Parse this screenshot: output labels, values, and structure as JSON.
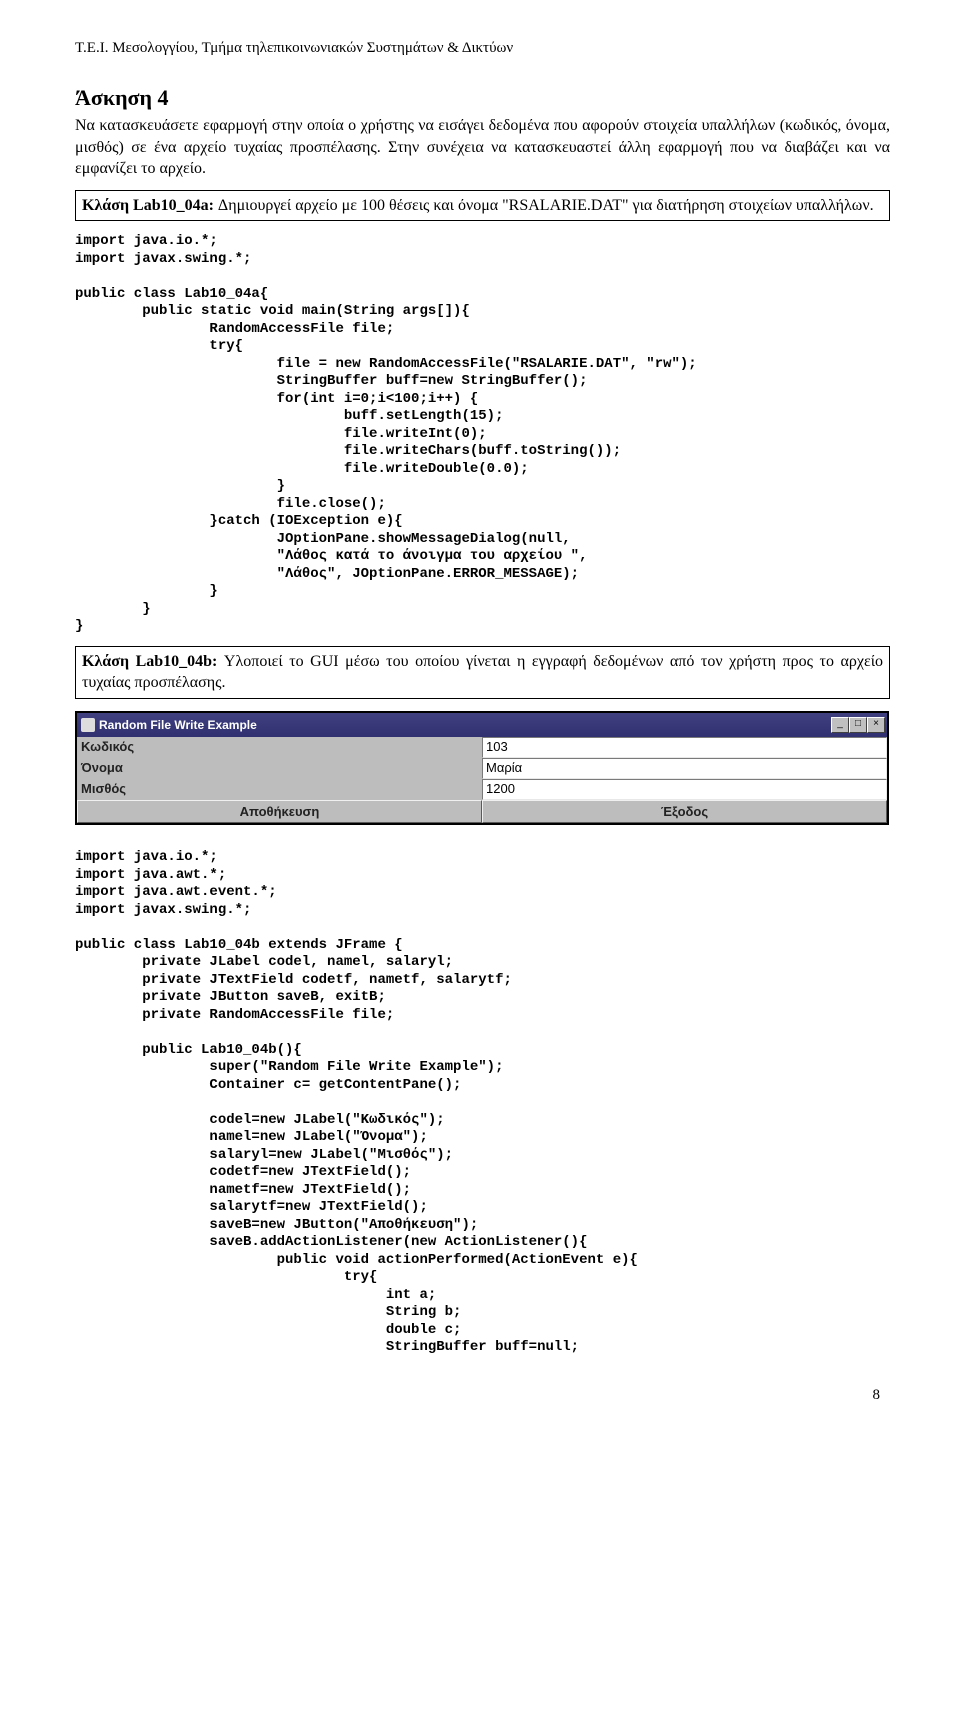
{
  "header": "T.E.I. Μεσολογγίου, Τμήμα τηλεπικοινωνιακών Συστημάτων & Δικτύων",
  "exercise_title": "Άσκηση 4",
  "intro": "Να κατασκευάσετε εφαρμογή στην οποία ο χρήστης να εισάγει δεδομένα που αφορούν στοιχεία υπαλλήλων (κωδικός, όνομα, μισθός) σε ένα αρχείο τυχαίας προσπέλασης. Στην συνέχεια να κατασκευαστεί άλλη εφαρμογή που να διαβάζει και να εμφανίζει το αρχείο.",
  "box1_label": "Κλάση Lab10_04a:",
  "box1_rest": " Δημιουργεί αρχείο με 100 θέσεις και όνομα \"RSALARIE.DAT\" για διατήρηση στοιχείων υπαλλήλων.",
  "code1": "import java.io.*;\nimport javax.swing.*;\n\npublic class Lab10_04a{\n        public static void main(String args[]){\n                RandomAccessFile file;\n                try{\n                        file = new RandomAccessFile(\"RSALARIE.DAT\", \"rw\");\n                        StringBuffer buff=new StringBuffer();\n                        for(int i=0;i<100;i++) {\n                                buff.setLength(15);\n                                file.writeInt(0);\n                                file.writeChars(buff.toString());\n                                file.writeDouble(0.0);\n                        }\n                        file.close();\n                }catch (IOException e){\n                        JOptionPane.showMessageDialog(null,\n                        \"Λάθος κατά το άνοιγμα του αρχείου \",\n                        \"Λάθος\", JOptionPane.ERROR_MESSAGE);\n                }\n        }\n}",
  "box2_label": "Κλάση Lab10_04b:",
  "box2_rest": " Υλοποιεί το GUI μέσω του οποίου γίνεται η εγγραφή  δεδομένων από τον χρήστη προς το αρχείο τυχαίας προσπέλασης.",
  "gui": {
    "title": "Random File Write Example",
    "labels": {
      "code": "Κωδικός",
      "name": "Όνομα",
      "salary": "Μισθός"
    },
    "values": {
      "code": "103",
      "name": "Μαρία",
      "salary": "1200"
    },
    "buttons": {
      "save": "Αποθήκευση",
      "exit": "Έξοδος"
    }
  },
  "code2": "import java.io.*;\nimport java.awt.*;\nimport java.awt.event.*;\nimport javax.swing.*;\n\npublic class Lab10_04b extends JFrame {\n        private JLabel codel, namel, salaryl;\n        private JTextField codetf, nametf, salarytf;\n        private JButton saveB, exitB;\n        private RandomAccessFile file;\n\n        public Lab10_04b(){\n                super(\"Random File Write Example\");\n                Container c= getContentPane();\n\n                codel=new JLabel(\"Κωδικός\");\n                namel=new JLabel(\"Όνομα\");\n                salaryl=new JLabel(\"Μισθός\");\n                codetf=new JTextField();\n                nametf=new JTextField();\n                salarytf=new JTextField();\n                saveB=new JButton(\"Αποθήκευση\");\n                saveB.addActionListener(new ActionListener(){\n                        public void actionPerformed(ActionEvent e){\n                                try{\n                                     int a;\n                                     String b;\n                                     double c;\n                                     StringBuffer buff=null;",
  "pagenum": "8"
}
